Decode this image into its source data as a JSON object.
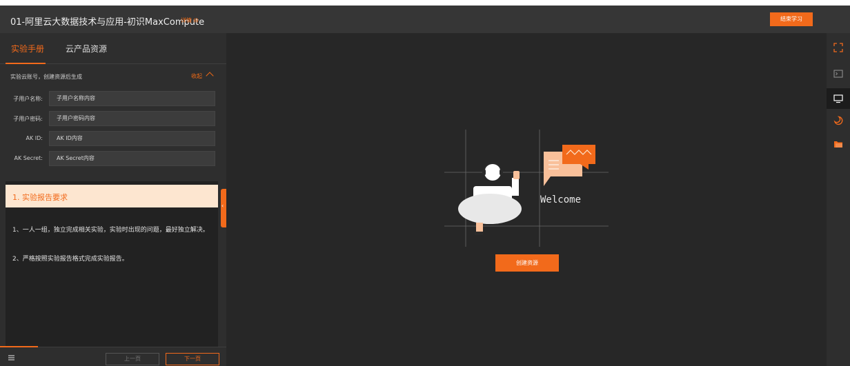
{
  "header": {
    "course_title": "01-阿里云大数据技术与应用-初识MaxCompute",
    "detail_link": "详情 ⊟",
    "end_button": "结束学习"
  },
  "tabs": [
    {
      "label": "实验手册",
      "active": true
    },
    {
      "label": "云产品资源",
      "active": false
    }
  ],
  "account": {
    "note": "实验云账号，创建资源后生成",
    "collapse_label": "收起",
    "fields": [
      {
        "label": "子用户名称:",
        "value": "子用户名称内容"
      },
      {
        "label": "子用户密码:",
        "value": "子用户密码内容"
      },
      {
        "label": "AK ID:",
        "value": "AK ID内容"
      },
      {
        "label": "AK Secret:",
        "value": "AK Secret内容"
      }
    ]
  },
  "doc": {
    "heading": "1. 实验报告要求",
    "paragraphs": [
      "1、一人一组，独立完成相关实验，实验时出现的问题，最好独立解决。",
      "2、严格按照实验报告格式完成实验报告。"
    ]
  },
  "footer": {
    "prev": "上一页",
    "next": "下一页"
  },
  "main": {
    "welcome": "Welcome",
    "create_button": "创建资源"
  },
  "rail": {
    "items": [
      "fullscreen-icon",
      "terminal-icon",
      "desktop-icon",
      "moon-icon",
      "folder-icon"
    ]
  },
  "colors": {
    "accent": "#f26a1b",
    "bg": "#262626",
    "panel": "#2e2e2e"
  }
}
